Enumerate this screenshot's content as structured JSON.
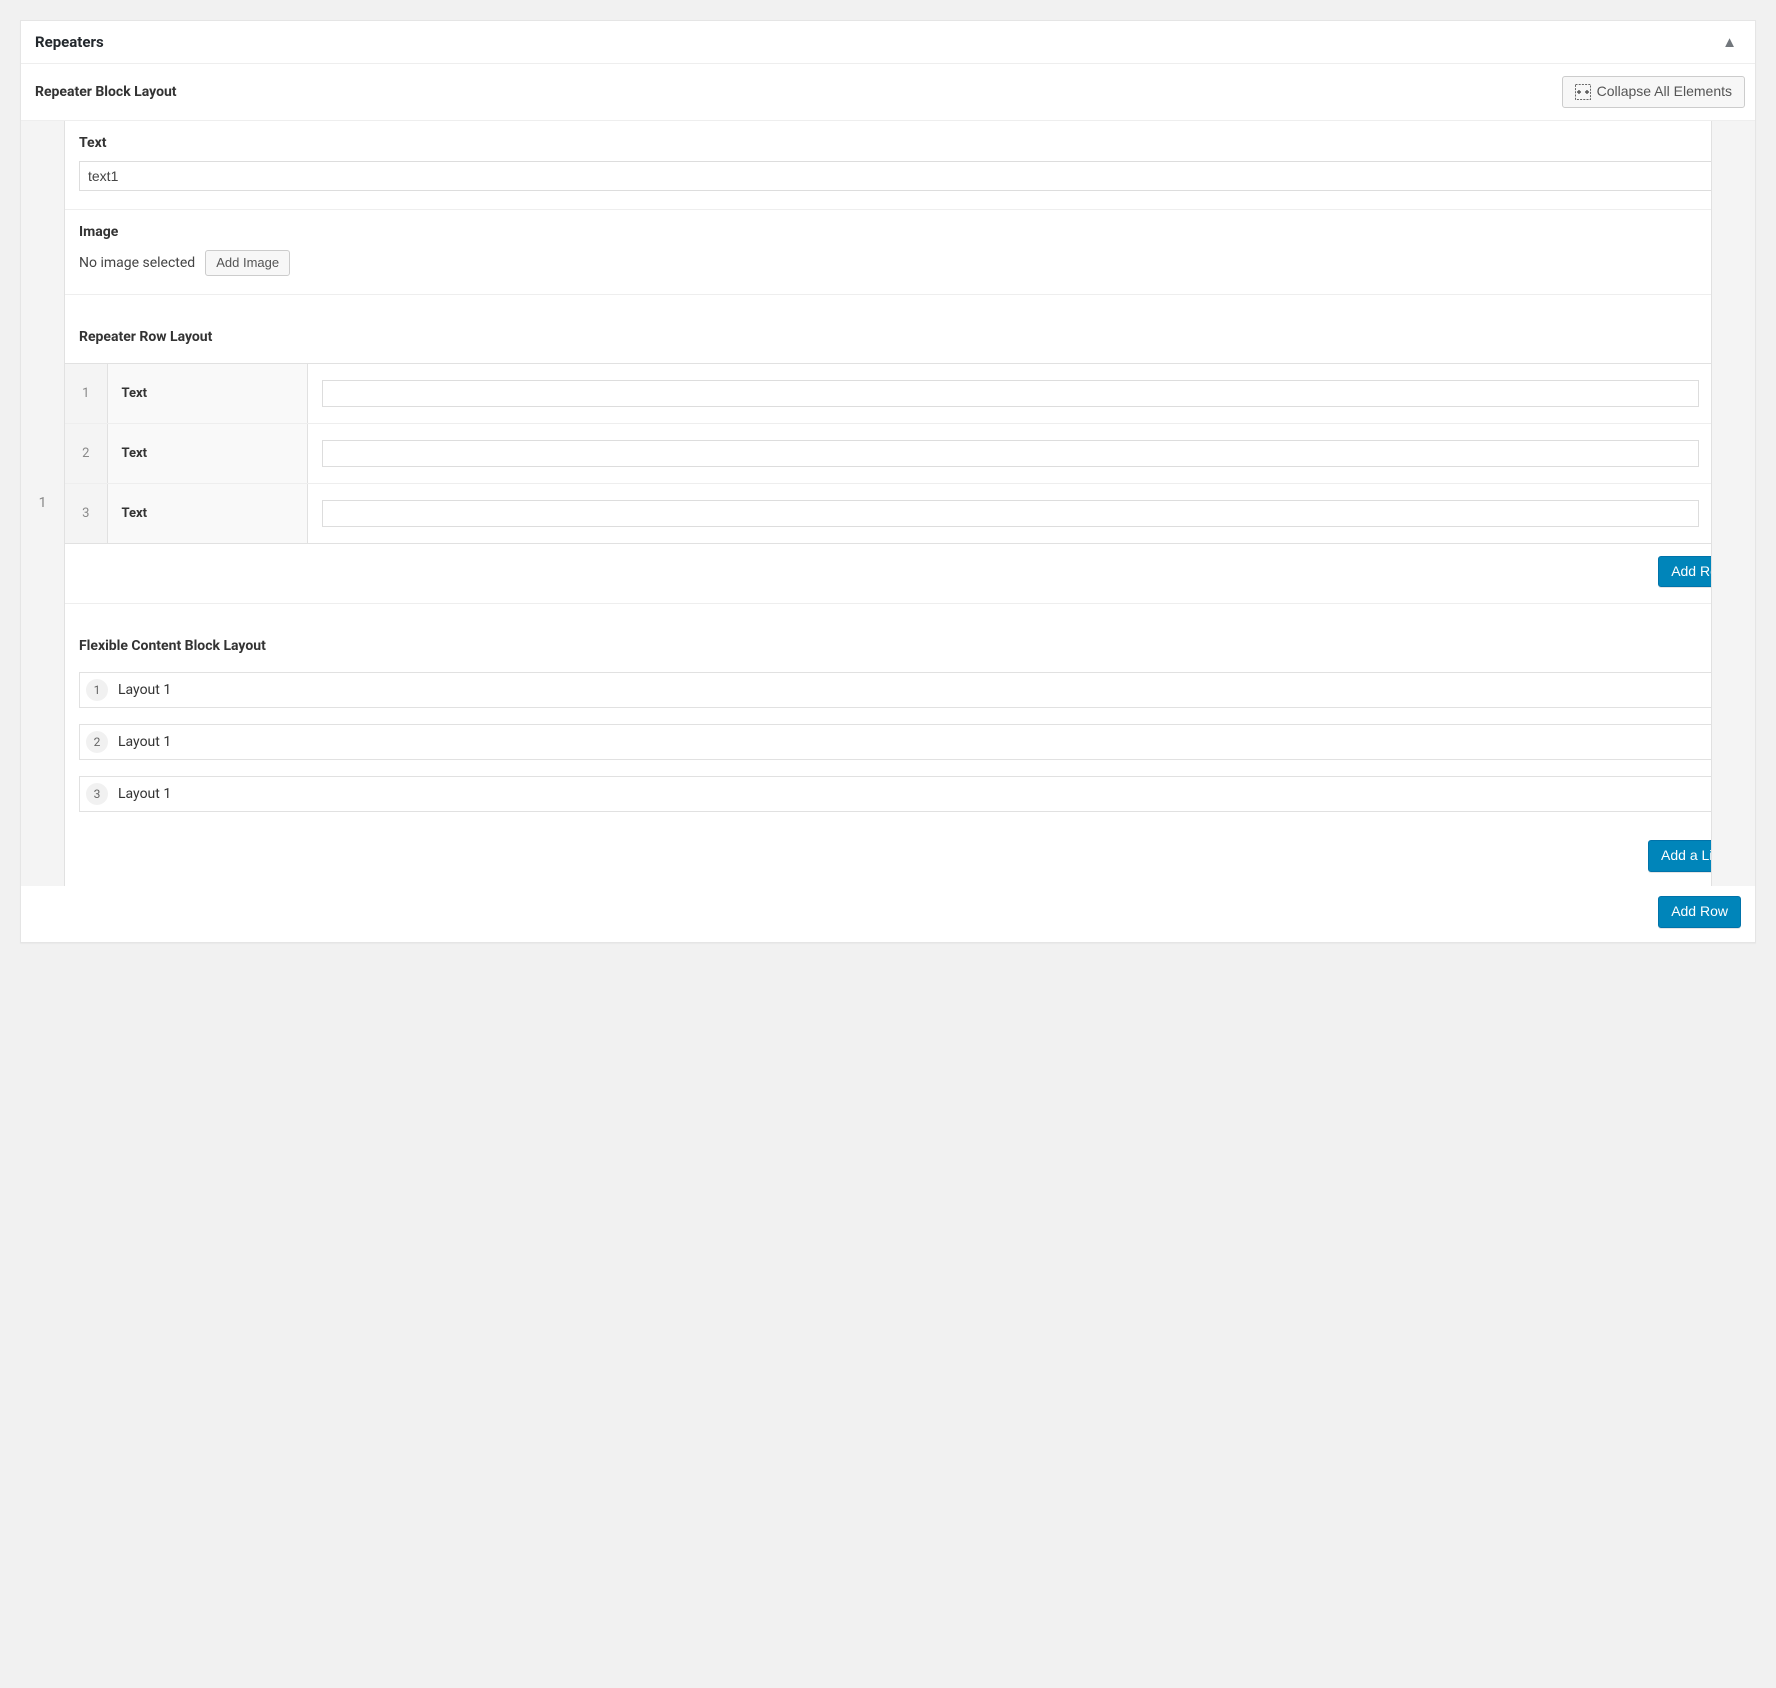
{
  "panel": {
    "title": "Repeaters"
  },
  "toolbar": {
    "section_title": "Repeater Block Layout",
    "collapse_label": "Collapse All Elements"
  },
  "outer_repeater": {
    "rows": [
      {
        "index": "1",
        "text_field": {
          "label": "Text",
          "value": "text1"
        },
        "image_field": {
          "label": "Image",
          "status_text": "No image selected",
          "add_button": "Add Image"
        },
        "row_layout": {
          "title": "Repeater Row Layout",
          "rows": [
            {
              "index": "1",
              "label": "Text",
              "value": ""
            },
            {
              "index": "2",
              "label": "Text",
              "value": ""
            },
            {
              "index": "3",
              "label": "Text",
              "value": ""
            }
          ],
          "add_button": "Add Row"
        },
        "flex_content": {
          "title": "Flexible Content Block Layout",
          "items": [
            {
              "index": "1",
              "label": "Layout 1"
            },
            {
              "index": "2",
              "label": "Layout 1"
            },
            {
              "index": "3",
              "label": "Layout 1"
            }
          ],
          "add_button": "Add a Line"
        }
      }
    ],
    "add_button": "Add Row"
  }
}
